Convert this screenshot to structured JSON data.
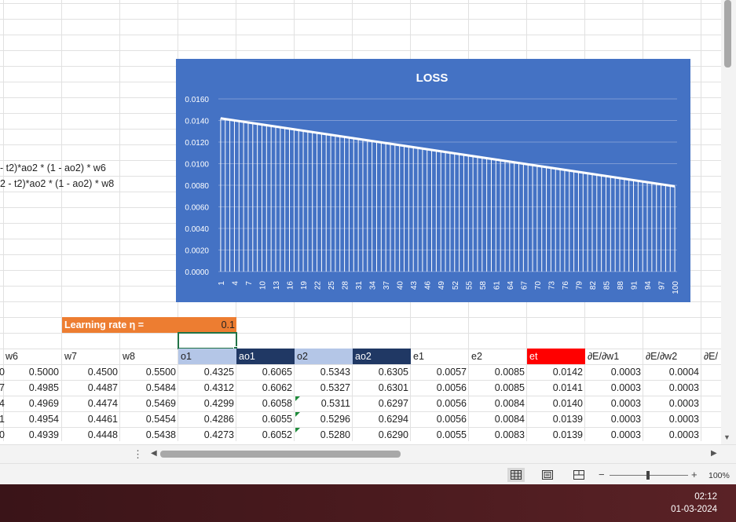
{
  "formulas": [
    " - t2)*ao2 * (1 - ao2) * w6",
    "2 - t2)*ao2 * (1 - ao2) * w8"
  ],
  "learning_rate": {
    "label": "Learning rate η =",
    "value": "0.1"
  },
  "headers": [
    {
      "label": "w6",
      "bg": "",
      "fg": "#222222"
    },
    {
      "label": "w7",
      "bg": "",
      "fg": "#222222"
    },
    {
      "label": "w8",
      "bg": "",
      "fg": "#222222"
    },
    {
      "label": "o1",
      "bg": "#b4c6e7",
      "fg": "#222222"
    },
    {
      "label": "ao1",
      "bg": "#203864",
      "fg": "#ffffff"
    },
    {
      "label": "o2",
      "bg": "#b4c6e7",
      "fg": "#222222"
    },
    {
      "label": "ao2",
      "bg": "#203864",
      "fg": "#ffffff"
    },
    {
      "label": "e1",
      "bg": "",
      "fg": "#222222"
    },
    {
      "label": "e2",
      "bg": "",
      "fg": "#222222"
    },
    {
      "label": "et",
      "bg": "#ff0000",
      "fg": "#ffffff"
    },
    {
      "label": "∂E/∂w1",
      "bg": "",
      "fg": "#222222"
    },
    {
      "label": "∂E/∂w2",
      "bg": "",
      "fg": "#222222"
    },
    {
      "label": "∂E/",
      "bg": "",
      "fg": "#222222"
    }
  ],
  "rows": [
    {
      "lead": "0",
      "values": [
        "0.5000",
        "0.4500",
        "0.5500",
        "0.4325",
        "0.6065",
        "0.5343",
        "0.6305",
        "0.0057",
        "0.0085",
        "0.0142",
        "0.0003",
        "0.0004"
      ]
    },
    {
      "lead": "7",
      "values": [
        "0.4985",
        "0.4487",
        "0.5484",
        "0.4312",
        "0.6062",
        "0.5327",
        "0.6301",
        "0.0056",
        "0.0085",
        "0.0141",
        "0.0003",
        "0.0003"
      ]
    },
    {
      "lead": "4",
      "values": [
        "0.4969",
        "0.4474",
        "0.5469",
        "0.4299",
        "0.6058",
        "0.5311",
        "0.6297",
        "0.0056",
        "0.0084",
        "0.0140",
        "0.0003",
        "0.0003"
      ]
    },
    {
      "lead": "1",
      "values": [
        "0.4954",
        "0.4461",
        "0.5454",
        "0.4286",
        "0.6055",
        "0.5296",
        "0.6294",
        "0.0056",
        "0.0084",
        "0.0139",
        "0.0003",
        "0.0003"
      ]
    },
    {
      "lead": "0",
      "values": [
        "0.4939",
        "0.4448",
        "0.5438",
        "0.4273",
        "0.6052",
        "0.5280",
        "0.6290",
        "0.0055",
        "0.0083",
        "0.0139",
        "0.0003",
        "0.0003"
      ]
    }
  ],
  "status": {
    "zoom": "100%",
    "zoom_minus": "−",
    "zoom_plus": "+"
  },
  "scroll": {
    "more_icon": "⋮",
    "left_arrow": "◀",
    "right_arrow": "▶",
    "down_arrow": "▼"
  },
  "clock": {
    "time": "02:12",
    "date": "01-03-2024"
  },
  "chart_data": {
    "type": "bar",
    "title": "LOSS",
    "x_start": 1,
    "x_end": 100,
    "x_tick_labels": [
      "1",
      "4",
      "7",
      "10",
      "13",
      "16",
      "19",
      "22",
      "25",
      "28",
      "31",
      "34",
      "37",
      "40",
      "43",
      "46",
      "49",
      "52",
      "55",
      "58",
      "61",
      "64",
      "67",
      "70",
      "73",
      "76",
      "79",
      "82",
      "85",
      "88",
      "91",
      "94",
      "97",
      "100"
    ],
    "y_start": 0.0142,
    "y_end": 0.0079,
    "ylim": [
      0,
      0.016
    ],
    "y_tick_labels": [
      "0.0000",
      "0.0020",
      "0.0040",
      "0.0060",
      "0.0080",
      "0.0100",
      "0.0120",
      "0.0140",
      "0.0160"
    ],
    "grid": true,
    "colors": {
      "background": "#4472c4",
      "bars": "#ffffff",
      "gridline": "#7d9bd4"
    }
  }
}
